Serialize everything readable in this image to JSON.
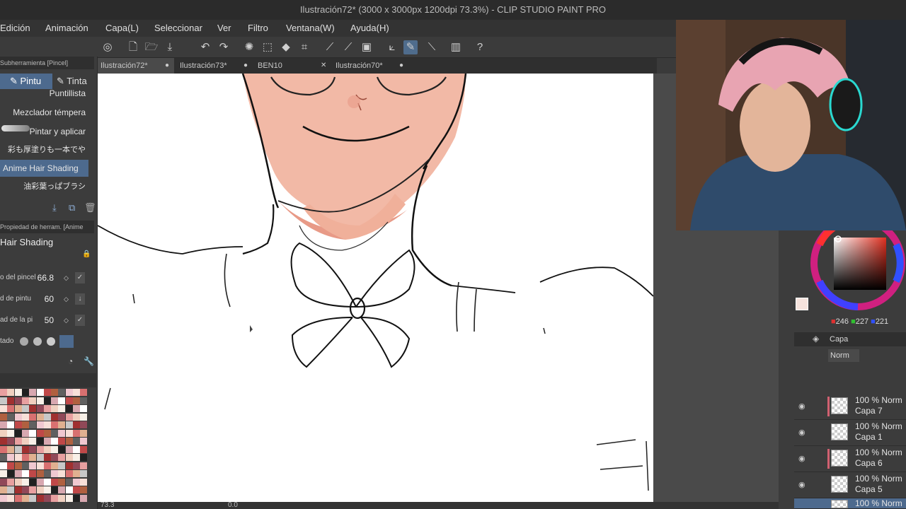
{
  "window": {
    "title": "Ilustración72* (3000 x 3000px 1200dpi 73.3%)  - CLIP STUDIO PAINT PRO"
  },
  "menu": [
    "Edición",
    "Animación",
    "Capa(L)",
    "Seleccionar",
    "Ver",
    "Filtro",
    "Ventana(W)",
    "Ayuda(H)"
  ],
  "tabs": [
    {
      "label": "Ilustración72*",
      "marker": "●"
    },
    {
      "label": "Ilustración73*",
      "marker": "●"
    },
    {
      "label": "BEN10",
      "marker": "✕"
    },
    {
      "label": "Ilustración70*",
      "marker": "●"
    }
  ],
  "subtool": {
    "header": "Subherramienta [Pincel]",
    "tab_active": "Pintu",
    "tab_other": "Tinta",
    "brushes": [
      "Puntillista",
      "Mezclador témpera",
      "Pintar y aplicar",
      "彩も厚塗りも一本でや",
      "Anime Hair Shading",
      "油彩葉っぱブラシ"
    ],
    "selected_index": 4
  },
  "tool_property": {
    "header": "Propiedad de herram. [Anime",
    "brush_name": "Hair Shading",
    "rows": [
      {
        "label": "o del pincel",
        "value": "66.8"
      },
      {
        "label": "d de pintu",
        "value": "60"
      },
      {
        "label": "ad de la pi",
        "value": "50"
      }
    ],
    "last_label": "tado"
  },
  "color": {
    "current": "#f6e3dd",
    "r": "246",
    "g": "227",
    "b": "221"
  },
  "layers_panel": {
    "tab": "Capa",
    "blend": "Norm",
    "layers": [
      {
        "opacity": "100 % Norm",
        "name": "Capa 7",
        "marked": true
      },
      {
        "opacity": "100 % Norm",
        "name": "Capa 1",
        "marked": false
      },
      {
        "opacity": "100 % Norm",
        "name": "Capa 6",
        "marked": true
      },
      {
        "opacity": "100 % Norm",
        "name": "Capa 5",
        "marked": false
      },
      {
        "opacity": "100 % Norm",
        "name": "",
        "marked": false
      }
    ]
  },
  "status": {
    "zoom": "73.3",
    "angle": "0.0"
  }
}
